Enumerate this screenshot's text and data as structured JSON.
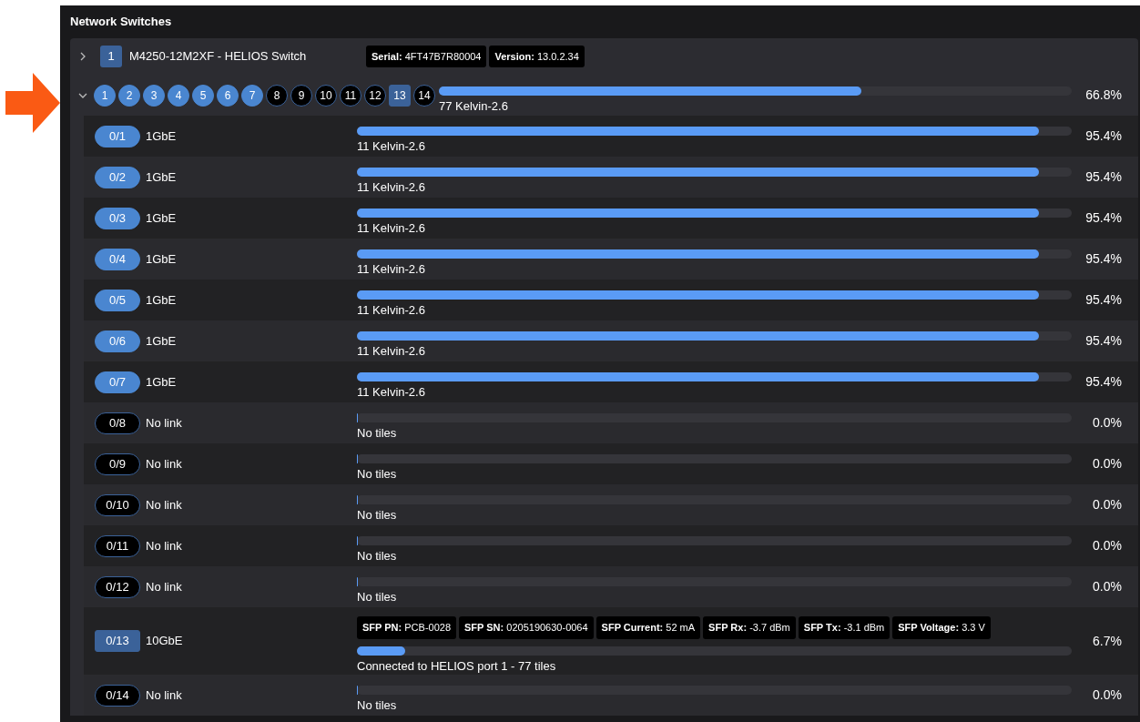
{
  "panel": {
    "title": "Network Switches"
  },
  "switch": {
    "expanded": false,
    "index": "1",
    "name": "M4250-12M2XF - HELIOS Switch",
    "badges": [
      {
        "label": "Serial:",
        "value": "4FT47B7R80004"
      },
      {
        "label": "Version:",
        "value": "13.0.2.34"
      }
    ]
  },
  "summary": {
    "expanded": true,
    "ports": [
      {
        "label": "1",
        "kind": "copper",
        "up": true
      },
      {
        "label": "2",
        "kind": "copper",
        "up": true
      },
      {
        "label": "3",
        "kind": "copper",
        "up": true
      },
      {
        "label": "4",
        "kind": "copper",
        "up": true
      },
      {
        "label": "5",
        "kind": "copper",
        "up": true
      },
      {
        "label": "6",
        "kind": "copper",
        "up": true
      },
      {
        "label": "7",
        "kind": "copper",
        "up": true
      },
      {
        "label": "8",
        "kind": "copper",
        "up": false
      },
      {
        "label": "9",
        "kind": "copper",
        "up": false
      },
      {
        "label": "10",
        "kind": "copper",
        "up": false
      },
      {
        "label": "11",
        "kind": "copper",
        "up": false
      },
      {
        "label": "12",
        "kind": "copper",
        "up": false
      },
      {
        "label": "13",
        "kind": "sfp",
        "up": true
      },
      {
        "label": "14",
        "kind": "copper",
        "up": false
      }
    ],
    "level": 0.668,
    "caption": "77 Kelvin-2.6",
    "percent": "66.8%"
  },
  "ports": [
    {
      "label": "0/1",
      "kind": "copper",
      "up": true,
      "speed": "1GbE",
      "level": 0.954,
      "caption": "11 Kelvin-2.6",
      "percent": "95.4%"
    },
    {
      "label": "0/2",
      "kind": "copper",
      "up": true,
      "speed": "1GbE",
      "level": 0.954,
      "caption": "11 Kelvin-2.6",
      "percent": "95.4%"
    },
    {
      "label": "0/3",
      "kind": "copper",
      "up": true,
      "speed": "1GbE",
      "level": 0.954,
      "caption": "11 Kelvin-2.6",
      "percent": "95.4%"
    },
    {
      "label": "0/4",
      "kind": "copper",
      "up": true,
      "speed": "1GbE",
      "level": 0.954,
      "caption": "11 Kelvin-2.6",
      "percent": "95.4%"
    },
    {
      "label": "0/5",
      "kind": "copper",
      "up": true,
      "speed": "1GbE",
      "level": 0.954,
      "caption": "11 Kelvin-2.6",
      "percent": "95.4%"
    },
    {
      "label": "0/6",
      "kind": "copper",
      "up": true,
      "speed": "1GbE",
      "level": 0.954,
      "caption": "11 Kelvin-2.6",
      "percent": "95.4%"
    },
    {
      "label": "0/7",
      "kind": "copper",
      "up": true,
      "speed": "1GbE",
      "level": 0.954,
      "caption": "11 Kelvin-2.6",
      "percent": "95.4%"
    },
    {
      "label": "0/8",
      "kind": "copper",
      "up": false,
      "speed": "No link",
      "level": 0,
      "caption": "No tiles",
      "percent": "0.0%"
    },
    {
      "label": "0/9",
      "kind": "copper",
      "up": false,
      "speed": "No link",
      "level": 0,
      "caption": "No tiles",
      "percent": "0.0%"
    },
    {
      "label": "0/10",
      "kind": "copper",
      "up": false,
      "speed": "No link",
      "level": 0,
      "caption": "No tiles",
      "percent": "0.0%"
    },
    {
      "label": "0/11",
      "kind": "copper",
      "up": false,
      "speed": "No link",
      "level": 0,
      "caption": "No tiles",
      "percent": "0.0%"
    },
    {
      "label": "0/12",
      "kind": "copper",
      "up": false,
      "speed": "No link",
      "level": 0,
      "caption": "No tiles",
      "percent": "0.0%"
    },
    {
      "label": "0/13",
      "kind": "sfp",
      "up": true,
      "speed": "10GbE",
      "level": 0.067,
      "caption": "Connected to HELIOS port 1 - 77 tiles",
      "percent": "6.7%",
      "badges": [
        {
          "label": "SFP PN:",
          "value": "PCB-0028"
        },
        {
          "label": "SFP SN:",
          "value": "0205190630-0064"
        },
        {
          "label": "SFP Current:",
          "value": "52 mA"
        },
        {
          "label": "SFP Rx:",
          "value": "-3.7 dBm"
        },
        {
          "label": "SFP Tx:",
          "value": "-3.1 dBm"
        },
        {
          "label": "SFP Voltage:",
          "value": "3.3 V"
        }
      ]
    },
    {
      "label": "0/14",
      "kind": "copper",
      "up": false,
      "speed": "No link",
      "level": 0,
      "caption": "No tiles",
      "percent": "0.0%"
    }
  ]
}
